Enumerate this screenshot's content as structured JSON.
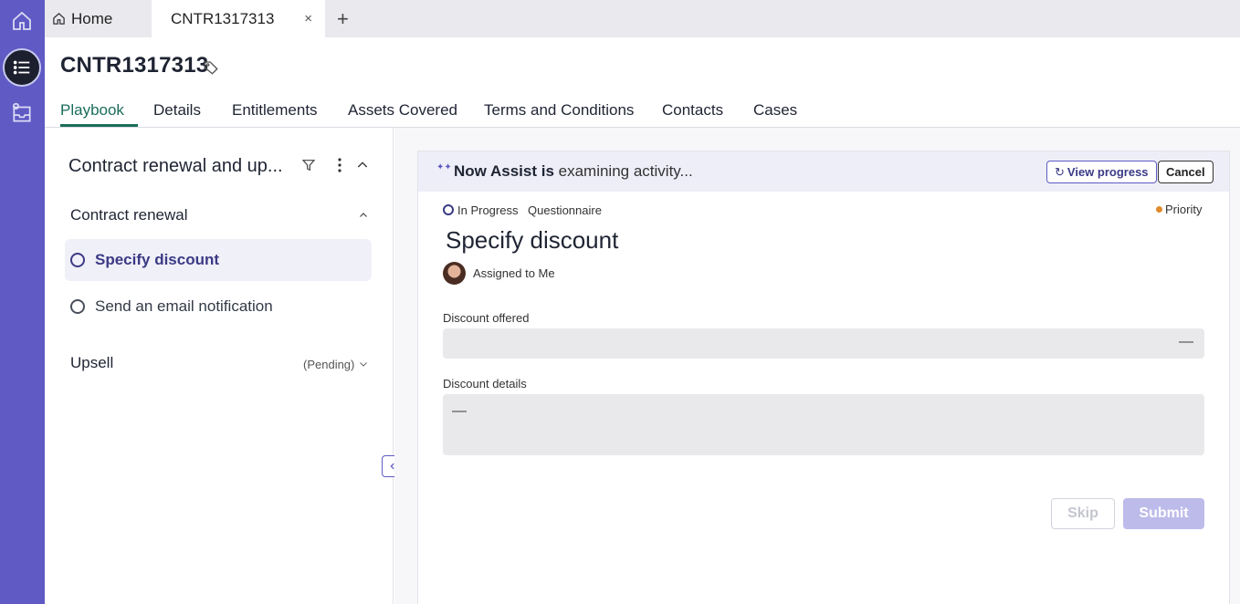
{
  "tabs": {
    "home_label": "Home",
    "record_label": "CNTR1317313",
    "close_glyph": "×",
    "add_glyph": "+"
  },
  "record": {
    "title": "CNTR1317313"
  },
  "subtabs": [
    "Playbook",
    "Details",
    "Entitlements",
    "Assets Covered",
    "Terms and Conditions",
    "Contacts",
    "Cases"
  ],
  "playbook": {
    "title": "Contract renewal and up...",
    "sections": [
      {
        "label": "Contract renewal",
        "tasks": [
          "Specify discount",
          "Send an email notification"
        ]
      },
      {
        "label": "Upsell",
        "status": "(Pending)"
      }
    ]
  },
  "assist": {
    "bold": "Now Assist is",
    "rest": " examining activity...",
    "view_progress": "View progress",
    "cancel": "Cancel"
  },
  "task": {
    "status": "In Progress",
    "type": "Questionnaire",
    "priority": "Priority",
    "title": "Specify discount",
    "assigned": "Assigned to Me",
    "fields": [
      {
        "label": "Discount offered",
        "value": "—"
      },
      {
        "label": "Discount details",
        "value": "—"
      }
    ],
    "skip": "Skip",
    "submit": "Submit"
  },
  "colors": {
    "rail": "#5f5ac4",
    "active_tab": "#1b6d5a",
    "priority": "#e08a2b",
    "submit_disabled": "#bdbbea"
  },
  "icons": [
    "home-icon",
    "list-icon",
    "inbox-icon",
    "tag-icon",
    "filter-icon",
    "kebab-icon",
    "chevron-up-icon",
    "chevron-down-icon",
    "chevron-left-icon",
    "sparkle-icon",
    "refresh-icon",
    "close-icon",
    "plus-icon"
  ]
}
